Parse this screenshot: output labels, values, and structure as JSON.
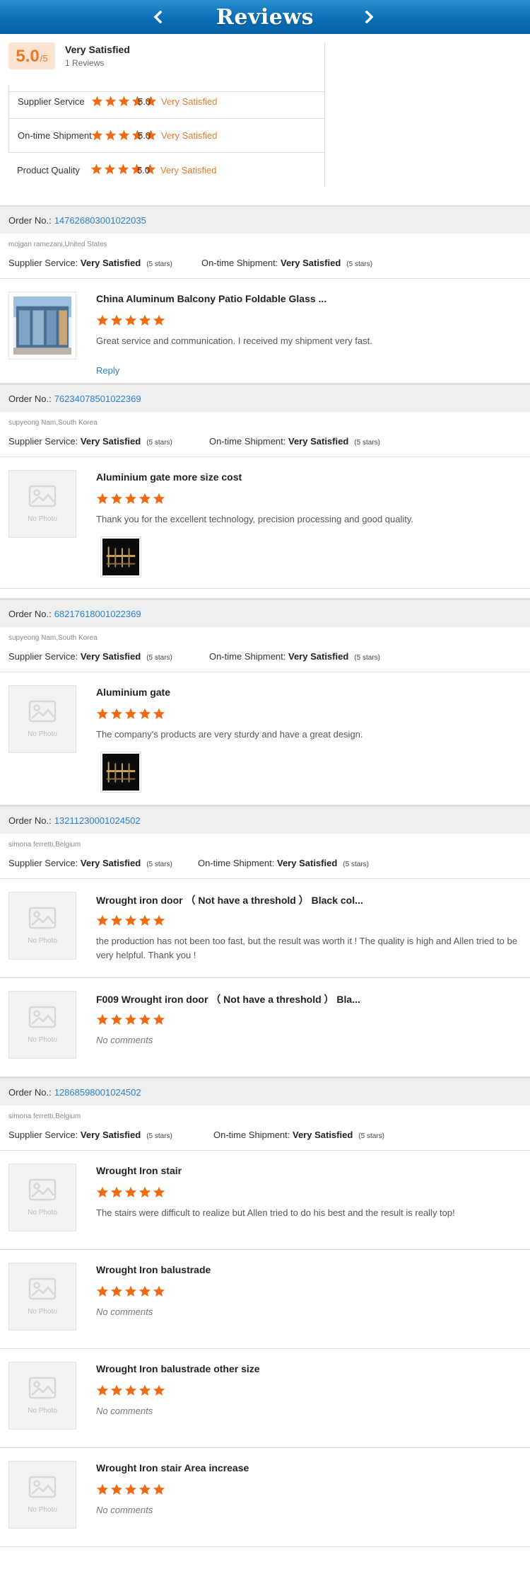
{
  "header": {
    "title": "Reviews",
    "prev": "previous",
    "next": "next"
  },
  "summary": {
    "score": "5.0",
    "score_max": "/5",
    "label": "Very Satisfied",
    "count": "1 Reviews",
    "rows": [
      {
        "label": "Supplier Service",
        "value": "5.0",
        "text": "Very Satisfied",
        "stars": 5
      },
      {
        "label": "On-time Shipment",
        "value": "5.0",
        "text": "Very Satisfied",
        "stars": 5
      },
      {
        "label": "Product Quality",
        "value": "5.0",
        "text": "Very Satisfied",
        "stars": 5
      }
    ]
  },
  "labels": {
    "order_no": "Order No.:",
    "supplier_service": "Supplier Service:",
    "on_time": "On-time Shipment:",
    "very_satisfied": "Very Satisfied",
    "five_stars": "(5 stars)",
    "no_photo": "No Photo",
    "reply": "Reply",
    "no_comments": "No comments"
  },
  "orders": [
    {
      "order_no": "147626803001022035",
      "buyer": "mojgan ramezani,United States",
      "items": [
        {
          "title": "China Aluminum Balcony Patio Foldable Glass ...",
          "comment": "Great service and communication. I received my shipment very fast.",
          "photo": true,
          "reply": true
        }
      ]
    },
    {
      "order_no": "76234078501022369",
      "buyer": "supyeong Nam,South Korea",
      "items": [
        {
          "title": "Aluminium gate more size cost",
          "comment": "Thank you for the excellent technology, precision processing and good quality.",
          "photo": false,
          "attach": true
        }
      ]
    },
    {
      "order_no": "68217618001022369",
      "buyer": "supyeong Nam,South Korea",
      "items": [
        {
          "title": "Aluminium gate",
          "comment": "The company's products are very sturdy and have a great design.",
          "photo": false,
          "attach": true
        }
      ]
    },
    {
      "order_no": "13211230001024502",
      "buyer": "simona ferretti,Belgium",
      "items": [
        {
          "title": "Wrought iron door （ Not have a threshold ） Black col...",
          "comment": "the production has not been too fast, but the result was worth it ! The quality is high and Allen tried to be very helpful. Thank you !",
          "photo": false
        },
        {
          "title": "F009 Wrought iron door （ Not have a threshold ） Bla...",
          "comment": "No comments",
          "photo": false,
          "empty": true
        }
      ]
    },
    {
      "order_no": "12868598001024502",
      "buyer": "simona ferretti,Belgium",
      "items": [
        {
          "title": "Wrought Iron stair",
          "comment": "The stairs were difficult to realize but Allen tried to do his best and the result is really top!",
          "photo": false
        },
        {
          "title": "Wrought Iron balustrade",
          "comment": "No comments",
          "photo": false,
          "empty": true
        },
        {
          "title": "Wrought Iron balustrade other size",
          "comment": "No comments",
          "photo": false,
          "empty": true
        },
        {
          "title": "Wrought Iron stair Area increase",
          "comment": "No comments",
          "photo": false,
          "empty": true
        }
      ]
    }
  ],
  "colors": {
    "accent": "#e7792b",
    "star": "#f06a14",
    "link": "#2a7fc6",
    "header": "#0a6fb5"
  }
}
